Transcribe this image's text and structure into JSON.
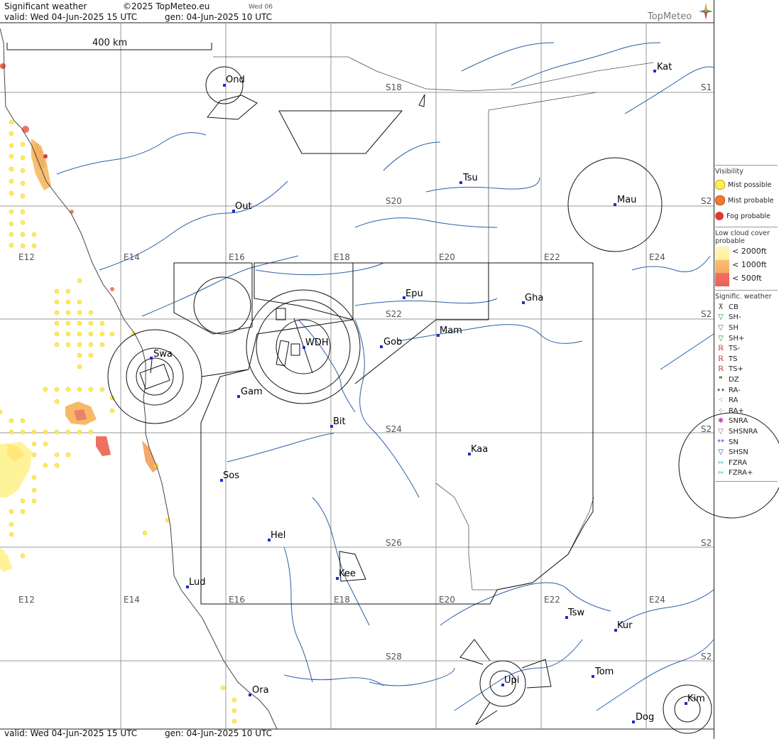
{
  "header": {
    "title": "Significant weather",
    "copyright": "©2025 TopMeteo.eu",
    "day_tab": "Wed 06",
    "valid": "valid:  Wed  04-Jun-2025  15 UTC",
    "generated": "gen: 04-Jun-2025 10 UTC",
    "logo": "TopMeteo"
  },
  "footer": {
    "valid": "valid:  Wed  04-Jun-2025  15 UTC",
    "generated": "gen: 04-Jun-2025 10 UTC"
  },
  "scale": {
    "label": "400 km"
  },
  "grid": {
    "lon_labels": [
      "E12",
      "E14",
      "E16",
      "E18",
      "E20",
      "E22",
      "E24"
    ],
    "lat_labels": [
      "S18",
      "S20",
      "S22",
      "S24",
      "S26",
      "S28"
    ],
    "edge_labels": [
      "S1",
      "S2",
      "S2",
      "S2",
      "S2",
      "S2"
    ]
  },
  "cities": [
    {
      "name": "Ond"
    },
    {
      "name": "Kat"
    },
    {
      "name": "Tsu"
    },
    {
      "name": "Mau"
    },
    {
      "name": "Out"
    },
    {
      "name": "Epu"
    },
    {
      "name": "Gha"
    },
    {
      "name": "Mam"
    },
    {
      "name": "Gob"
    },
    {
      "name": "WDH"
    },
    {
      "name": "Swa"
    },
    {
      "name": "Gam"
    },
    {
      "name": "Bit"
    },
    {
      "name": "Kaa"
    },
    {
      "name": "Sos"
    },
    {
      "name": "Hel"
    },
    {
      "name": "Lud"
    },
    {
      "name": "Kee"
    },
    {
      "name": "Tsw"
    },
    {
      "name": "Kur"
    },
    {
      "name": "Tom"
    },
    {
      "name": "Upi"
    },
    {
      "name": "Ora"
    },
    {
      "name": "Kim"
    },
    {
      "name": "Dog"
    }
  ],
  "legend": {
    "visibility_title": "Visibility",
    "visibility": [
      {
        "label": "Mist possible",
        "color": "#ffee55"
      },
      {
        "label": "Mist probable",
        "color": "#f07a30"
      },
      {
        "label": "Fog probable",
        "color": "#e03a30"
      }
    ],
    "low_cloud_title": "Low cloud cover probable",
    "low_cloud": [
      "< 2000ft",
      "< 1000ft",
      "<   500ft"
    ],
    "sigwx_title": "Signific. weather",
    "sigwx": [
      {
        "label": "CB",
        "icon": "cb-icon",
        "glyph": "⊼",
        "color": "#333333"
      },
      {
        "label": "SH-",
        "icon": "shower-light-icon",
        "glyph": "▽",
        "color": "#228822"
      },
      {
        "label": "SH",
        "icon": "shower-icon",
        "glyph": "▽",
        "color": "#228822"
      },
      {
        "label": "SH+",
        "icon": "shower-heavy-icon",
        "glyph": "▽",
        "color": "#228822"
      },
      {
        "label": "TS-",
        "icon": "thunder-light-icon",
        "glyph": "ℝ",
        "color": "#cc2222"
      },
      {
        "label": "TS",
        "icon": "thunder-icon",
        "glyph": "ℝ",
        "color": "#cc2222"
      },
      {
        "label": "TS+",
        "icon": "thunder-heavy-icon",
        "glyph": "ℝ",
        "color": "#cc2222"
      },
      {
        "label": "DZ",
        "icon": "drizzle-icon",
        "glyph": "❞",
        "color": "#116611"
      },
      {
        "label": "RA-",
        "icon": "rain-light-icon",
        "glyph": "••",
        "color": "#116611"
      },
      {
        "label": "RA",
        "icon": "rain-icon",
        "glyph": "⁖",
        "color": "#116611"
      },
      {
        "label": "RA+",
        "icon": "rain-heavy-icon",
        "glyph": "⁘",
        "color": "#116611"
      },
      {
        "label": "SNRA",
        "icon": "snow-rain-icon",
        "glyph": "✱",
        "color": "#bb44bb"
      },
      {
        "label": "SHSNRA",
        "icon": "shower-snow-rain-icon",
        "glyph": "▽",
        "color": "#bb44bb"
      },
      {
        "label": "SN",
        "icon": "snow-icon",
        "glyph": "**",
        "color": "#2244cc"
      },
      {
        "label": "SHSN",
        "icon": "shower-snow-icon",
        "glyph": "▽",
        "color": "#2244cc"
      },
      {
        "label": "FZRA",
        "icon": "freezing-rain-icon",
        "glyph": "∾",
        "color": "#22aacc"
      },
      {
        "label": "FZRA+",
        "icon": "freezing-rain-heavy-icon",
        "glyph": "∾",
        "color": "#22aacc"
      }
    ]
  }
}
